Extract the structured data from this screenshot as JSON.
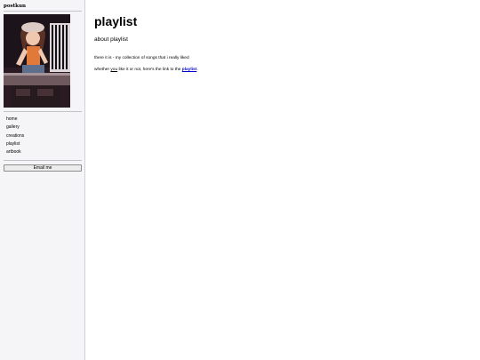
{
  "sidebar": {
    "site_title": "postkun",
    "nav": [
      {
        "label": "home"
      },
      {
        "label": "gallery"
      },
      {
        "label": "creations"
      },
      {
        "label": "playlist"
      },
      {
        "label": "artbook"
      }
    ],
    "email_button": "Email me"
  },
  "main": {
    "title": "playlist",
    "subtitle": "about playlist",
    "paragraph1": "there it is - my collection of songs that i really liked",
    "paragraph2": {
      "before": "whether ",
      "emphasis": "you",
      "middle": " like it or not, here's the link to the ",
      "link": "playlist",
      "after": "."
    }
  },
  "colors": {
    "sidebar_bg": "#f5f5f7",
    "link": "#0000cc"
  }
}
